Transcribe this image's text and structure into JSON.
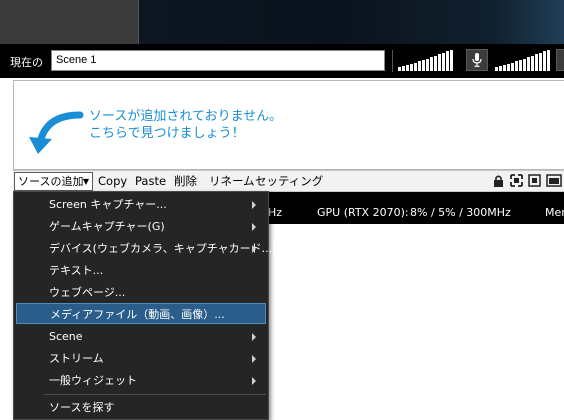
{
  "scene": {
    "label": "現在の",
    "name": "Scene 1"
  },
  "sources": {
    "hint_line1": "ソースが追加されておりません。",
    "hint_line2": "こちらで見つけましょう！"
  },
  "toolbar": {
    "add_source": "ソースの追加",
    "copy": "Copy",
    "paste": "Paste",
    "delete": "削除",
    "rename": "リネーム",
    "settings": "セッティング"
  },
  "status": {
    "freq_tail": "Hz",
    "gpu": "GPU (RTX 2070):",
    "gpu_value": "8% / 5% / 300MHz",
    "mem": "Mem"
  },
  "menu": {
    "items": [
      {
        "label": "Screen キャプチャー...",
        "submenu": true
      },
      {
        "label": "ゲームキャプチャー(G)",
        "submenu": true
      },
      {
        "label": "デバイス(ウェブカメラ、キャプチャカード...)",
        "submenu": true
      },
      {
        "label": "テキスト...",
        "submenu": false
      },
      {
        "label": "ウェブページ...",
        "submenu": false
      },
      {
        "label": "メディアファイル（動画、画像）...",
        "submenu": false,
        "highlighted": true
      },
      {
        "label": "Scene",
        "submenu": true
      },
      {
        "label": "ストリーム",
        "submenu": true
      },
      {
        "label": "一般ウィジェット",
        "submenu": true
      },
      {
        "label": "ソースを探す",
        "submenu": false
      }
    ]
  },
  "colors": {
    "accent": "#1a8ed4",
    "menu_bg": "#252525",
    "menu_highlight": "#2b5d8a"
  },
  "icons": {
    "mic": "microphone-icon",
    "lock": "lock-icon",
    "fit": "fit-screen-icon",
    "fullscreen": "fullscreen-icon",
    "window": "window-icon"
  }
}
